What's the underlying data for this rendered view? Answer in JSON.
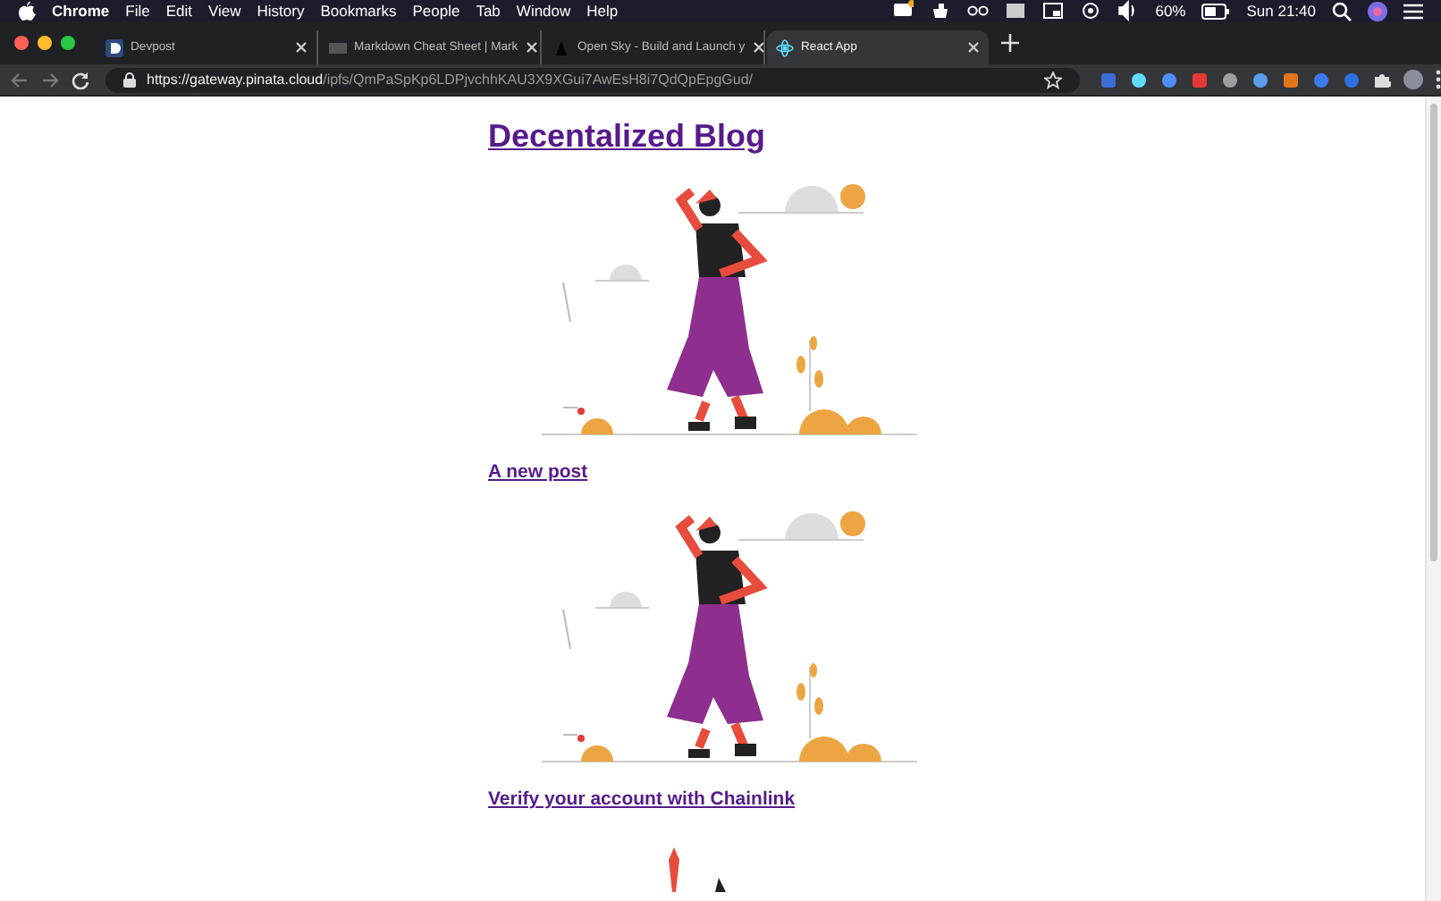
{
  "menu_bar": {
    "app_name": "Chrome",
    "menus": [
      "File",
      "Edit",
      "View",
      "History",
      "Bookmarks",
      "People",
      "Tab",
      "Window",
      "Help"
    ],
    "battery": "60%",
    "clock": "Sun 21:40"
  },
  "tabs": [
    {
      "title": "Devpost",
      "selected": false
    },
    {
      "title": "Markdown Cheat Sheet | Mark",
      "selected": false
    },
    {
      "title": "Open Sky - Build and Launch y",
      "selected": false
    },
    {
      "title": "React App",
      "selected": true
    }
  ],
  "address_bar": {
    "url_host": "https://gateway.pinata.cloud",
    "url_path": "/ipfs/QmPaSpKp6LDPjvchhKAU3X9XGui7AwEsH8i7QdQpEpgGud/"
  },
  "page": {
    "title": "Decentalized Blog",
    "posts": [
      {
        "title": "A new post"
      },
      {
        "title": "Verify your account with Chainlink"
      }
    ]
  }
}
